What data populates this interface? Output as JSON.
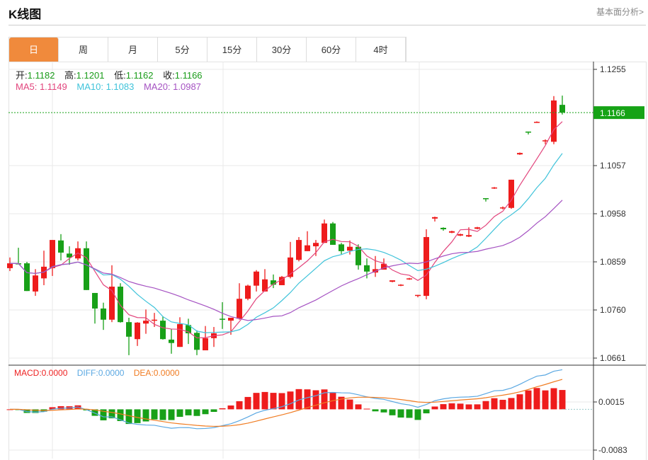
{
  "header": {
    "title": "K线图",
    "more_link": "基本面分析>"
  },
  "tabs": [
    {
      "label": "日",
      "active": true
    },
    {
      "label": "周"
    },
    {
      "label": "月"
    },
    {
      "label": "5分"
    },
    {
      "label": "15分"
    },
    {
      "label": "30分"
    },
    {
      "label": "60分"
    },
    {
      "label": "4时"
    }
  ],
  "ohlc_legend": {
    "open_label": "开:",
    "open": "1.1182",
    "high_label": "高:",
    "high": "1.1201",
    "low_label": "低:",
    "low": "1.1162",
    "close_label": "收:",
    "close": "1.1166"
  },
  "ma_legend": {
    "ma5": "MA5: 1.1149",
    "ma10": "MA10: 1.1083",
    "ma20": "MA20: 1.0987"
  },
  "macd_legend": {
    "macd": "MACD:0.0000",
    "diff": "DIFF:0.0000",
    "dea": "DEA:0.0000"
  },
  "colors": {
    "up": "#ee1c1c",
    "down": "#18a018",
    "ma5": "#e2457d",
    "ma10": "#3fc3da",
    "ma20": "#a552c2",
    "diff": "#5ba8e2",
    "dea": "#f07c22",
    "active_tab": "#f08a3c"
  },
  "chart_data": {
    "type": "candlestick",
    "price_axis": {
      "ticks": [
        "1.1255",
        "1.1057",
        "1.0958",
        "1.0859",
        "1.0760",
        "1.0661"
      ],
      "range": [
        1.0661,
        1.1255
      ]
    },
    "current_price": "1.1166",
    "macd_axis": {
      "ticks": [
        "0.0015",
        "-0.0083"
      ]
    },
    "candles": [
      [
        1.0846,
        1.0856,
        1.0868,
        1.084
      ],
      [
        1.0856,
        1.0855,
        1.0888,
        1.0854
      ],
      [
        1.0856,
        1.0799,
        1.0859,
        1.0799
      ],
      [
        1.0798,
        1.0831,
        1.0844,
        1.0789
      ],
      [
        1.0825,
        1.0849,
        1.0882,
        1.0811
      ],
      [
        1.0846,
        1.0904,
        1.0904,
        1.083
      ],
      [
        1.0903,
        1.0878,
        1.0916,
        1.0862
      ],
      [
        1.0876,
        1.0868,
        1.0891,
        1.0853
      ],
      [
        1.0866,
        1.0887,
        1.0901,
        1.0862
      ],
      [
        1.0887,
        1.0801,
        1.0901,
        1.0801
      ],
      [
        1.0795,
        1.0763,
        1.0795,
        1.0732
      ],
      [
        1.0763,
        1.074,
        1.0775,
        1.0719
      ],
      [
        1.074,
        1.0808,
        1.0852,
        1.0735
      ],
      [
        1.0808,
        1.0735,
        1.0815,
        1.0734
      ],
      [
        1.0735,
        1.0705,
        1.0744,
        1.0667
      ],
      [
        1.07,
        1.0734,
        1.0735,
        1.0686
      ],
      [
        1.0732,
        1.0738,
        1.0761,
        1.0711
      ],
      [
        1.074,
        1.074,
        1.0754,
        1.0725
      ],
      [
        1.0738,
        1.07,
        1.0747,
        1.0699
      ],
      [
        1.0699,
        1.0692,
        1.0721,
        1.067
      ],
      [
        1.0684,
        1.0731,
        1.0745,
        1.0684
      ],
      [
        1.0729,
        1.0712,
        1.0742,
        1.069
      ],
      [
        1.0713,
        1.0678,
        1.0718,
        1.0667
      ],
      [
        1.0677,
        1.0702,
        1.0727,
        1.0677
      ],
      [
        1.0702,
        1.0712,
        1.0725,
        1.0684
      ],
      [
        1.0742,
        1.074,
        1.0776,
        1.0721
      ],
      [
        1.0738,
        1.0744,
        1.0744,
        1.0709
      ],
      [
        1.0742,
        1.0783,
        1.0815,
        1.074
      ],
      [
        1.0783,
        1.081,
        1.0812,
        1.078
      ],
      [
        1.081,
        1.0839,
        1.0842,
        1.0798
      ],
      [
        1.0798,
        1.0823,
        1.0844,
        1.0798
      ],
      [
        1.0821,
        1.0812,
        1.0833,
        1.0805
      ],
      [
        1.0811,
        1.0828,
        1.083,
        1.0811
      ],
      [
        1.0828,
        1.0868,
        1.09,
        1.0825
      ],
      [
        1.0863,
        1.0904,
        1.091,
        1.086
      ],
      [
        1.0881,
        1.0893,
        1.0922,
        1.0881
      ],
      [
        1.0891,
        1.0898,
        1.0904,
        1.0871
      ],
      [
        1.0898,
        1.0938,
        1.0946,
        1.0898
      ],
      [
        1.0938,
        1.0894,
        1.0941,
        1.0894
      ],
      [
        1.0895,
        1.0881,
        1.0898,
        1.0875
      ],
      [
        1.0882,
        1.089,
        1.0903,
        1.0874
      ],
      [
        1.089,
        1.0852,
        1.0895,
        1.0843
      ],
      [
        1.0852,
        1.0839,
        1.0866,
        1.0825
      ],
      [
        1.0837,
        1.0844,
        1.0871,
        1.0828
      ],
      [
        1.0843,
        1.0855,
        1.0866,
        1.0843
      ],
      [
        1.0818,
        1.0821,
        1.0821,
        1.0817
      ],
      [
        1.081,
        1.0812,
        1.0813,
        1.0809
      ],
      [
        1.0823,
        1.0825,
        1.0826,
        1.0822
      ],
      [
        1.0789,
        1.0791,
        1.0791,
        1.0786
      ],
      [
        1.0789,
        1.091,
        1.0926,
        1.0782
      ],
      [
        1.0948,
        1.0951,
        1.0952,
        1.0942
      ],
      [
        1.0929,
        1.0926,
        1.093,
        1.0923
      ],
      [
        1.0919,
        1.0922,
        1.0923,
        1.0918
      ],
      [
        1.0913,
        1.0916,
        1.0917,
        1.0912
      ],
      [
        1.0911,
        1.0914,
        1.093,
        1.091
      ],
      [
        1.0927,
        1.093,
        1.0931,
        1.0926
      ],
      [
        1.099,
        1.0989,
        1.099,
        1.0983
      ],
      [
        1.101,
        1.1012,
        1.1013,
        1.1009
      ],
      [
        1.097,
        1.0971,
        1.0973,
        1.0967
      ],
      [
        1.097,
        1.1028,
        1.1028,
        1.0968
      ],
      [
        1.108,
        1.1083,
        1.1084,
        1.1079
      ],
      [
        1.1127,
        1.1125,
        1.1127,
        1.1121
      ],
      [
        1.1146,
        1.1147,
        1.1148,
        1.1145
      ],
      [
        1.1108,
        1.1109,
        1.1111,
        1.1101
      ],
      [
        1.1106,
        1.1191,
        1.12,
        1.1101
      ],
      [
        1.1182,
        1.1166,
        1.1201,
        1.1162
      ]
    ]
  }
}
